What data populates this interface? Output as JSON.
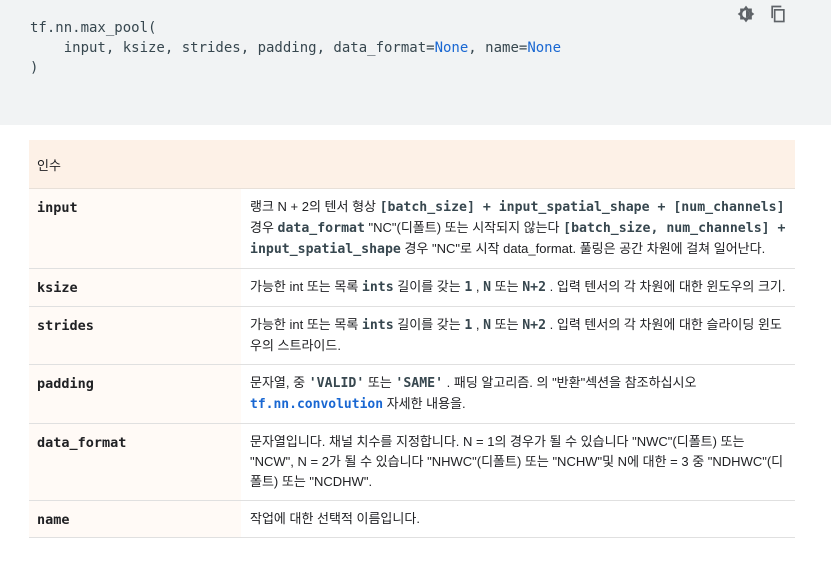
{
  "code": {
    "line1": "tf.nn.max_pool(",
    "line2_pre": "    input, ksize, strides, padding, data_format=",
    "none1": "None",
    "line2_mid": ", name=",
    "none2": "None",
    "line3": ")"
  },
  "toolbar": {
    "theme_icon": "dark-mode-icon",
    "copy_icon": "copy-icon"
  },
  "table": {
    "header": "인수",
    "rows": {
      "input": {
        "name": "input",
        "t1": "랭크 N + 2의 텐서 형상 ",
        "c1": "[batch_size] + input_spatial_shape + [num_channels]",
        "t2": " 경우 ",
        "c2": "data_format",
        "t3": " \"NC\"(디폴트) 또는 시작되지 않는다 ",
        "c3": "[batch_size, num_channels] + input_spatial_shape",
        "t4": " 경우 \"NC\"로 시작 data_format. 풀링은 공간 차원에 걸쳐 일어난다."
      },
      "ksize": {
        "name": "ksize",
        "t1": "가능한 int 또는 목록 ",
        "c1": "ints",
        "t2": " 길이를 갖는 ",
        "c2": "1",
        "t3": " , ",
        "c3": "N",
        "t4": " 또는 ",
        "c4": "N+2",
        "t5": " . 입력 텐서의 각 차원에 대한 윈도우의 크기."
      },
      "strides": {
        "name": "strides",
        "t1": "가능한 int 또는 목록 ",
        "c1": "ints",
        "t2": " 길이를 갖는 ",
        "c2": "1",
        "t3": " , ",
        "c3": "N",
        "t4": " 또는 ",
        "c4": "N+2",
        "t5": " . 입력 텐서의 각 차원에 대한 슬라이딩 윈도우의 스트라이드."
      },
      "padding": {
        "name": "padding",
        "t1": "문자열, 중 ",
        "c1": "'VALID'",
        "t2": " 또는 ",
        "c2": "'SAME'",
        "t3": " . 패딩 알고리즘. 의 \"반환\"섹션을 참조하십시오 ",
        "link": "tf.nn.convolution",
        "t4": " 자세한 내용을."
      },
      "data_format": {
        "name": "data_format",
        "text": "문자열입니다. 채널 치수를 지정합니다. N = 1의 경우가 될 수 있습니다 \"NWC\"(디폴트) 또는 \"NCW\", N = 2가 될 수 있습니다 \"NHWC\"(디폴트) 또는 \"NCHW\"및 N에 대한 = 3 중 \"NDHWC\"(디폴트) 또는 \"NCDHW\"."
      },
      "name": {
        "name": "name",
        "text": "작업에 대한 선택적 이름입니다."
      }
    }
  },
  "colors": {
    "code_bg": "#f1f3f4",
    "header_bg": "#fdf1e7",
    "link": "#1967d2"
  }
}
